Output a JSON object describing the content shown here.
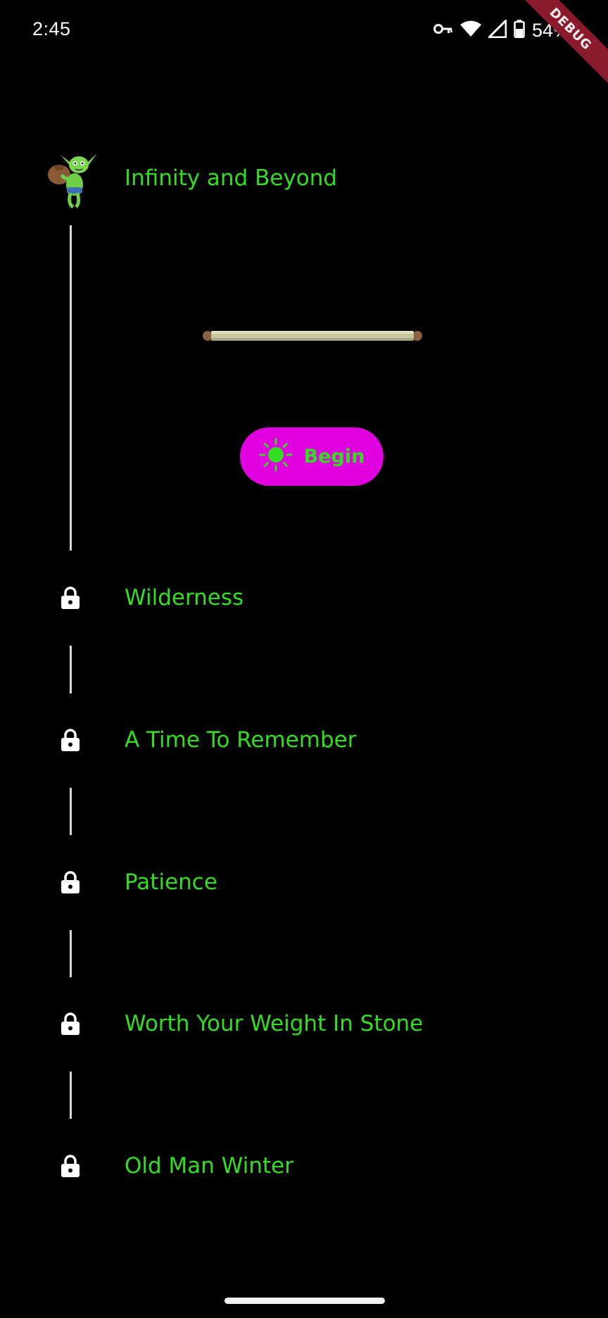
{
  "status_bar": {
    "time": "2:45",
    "battery": "54%",
    "debug_label": "DEBUG",
    "icons": [
      "vpn-key-icon",
      "wifi-icon",
      "signal-icon",
      "battery-icon"
    ]
  },
  "current_level": {
    "title": "Infinity and Beyond",
    "icon": "goblin-character-icon",
    "progress_icon": "scroll-stick-icon"
  },
  "begin_button": {
    "label": "Begin",
    "icon": "sun-icon"
  },
  "locked_levels": [
    {
      "title": "Wilderness",
      "icon": "lock-icon"
    },
    {
      "title": "A Time To Remember",
      "icon": "lock-icon"
    },
    {
      "title": "Patience",
      "icon": "lock-icon"
    },
    {
      "title": "Worth Your Weight In Stone",
      "icon": "lock-icon"
    },
    {
      "title": "Old Man Winter",
      "icon": "lock-icon"
    }
  ],
  "colors": {
    "background": "#000000",
    "title_text": "#33dd22",
    "button_bg": "#e000e0",
    "button_text": "#33dd22",
    "timeline": "#d8d8d8"
  }
}
